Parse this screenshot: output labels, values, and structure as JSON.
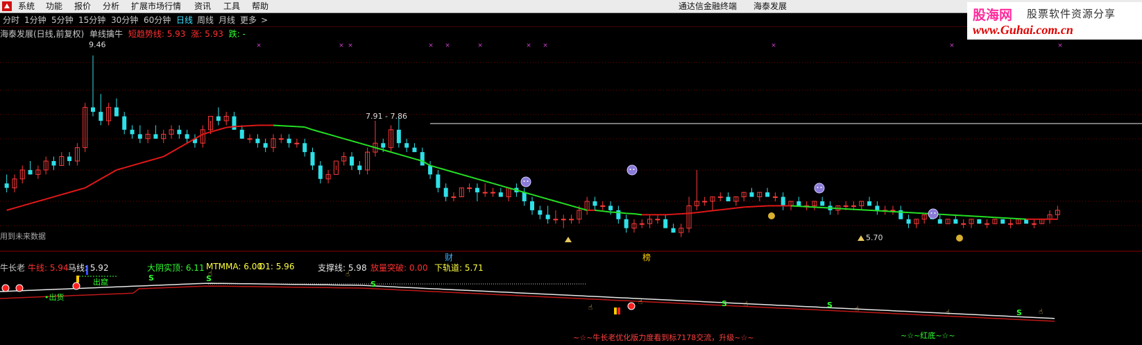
{
  "menubar": {
    "items": [
      "系统",
      "功能",
      "报价",
      "分析",
      "扩展市场行情",
      "资讯",
      "工具",
      "帮助"
    ],
    "app_title": "通达信金融终端",
    "doc_title": "海泰发展"
  },
  "brand": {
    "cn": "股海网",
    "slogan": "股票软件资源分享",
    "url": "www.Guhai.com.cn"
  },
  "tabs": [
    {
      "label": "分时",
      "active": false
    },
    {
      "label": "1分钟",
      "active": false
    },
    {
      "label": "5分钟",
      "active": false
    },
    {
      "label": "15分钟",
      "active": false
    },
    {
      "label": "30分钟",
      "active": false
    },
    {
      "label": "60分钟",
      "active": false
    },
    {
      "label": "日线",
      "active": true
    },
    {
      "label": "周线",
      "active": false
    },
    {
      "label": "月线",
      "active": false
    },
    {
      "label": "更多",
      "active": false
    },
    {
      "label": ">",
      "active": false
    }
  ],
  "main_legend": {
    "stock": "海泰发展(日线,前复权)",
    "indicator": "单线擒牛",
    "trend_label": "短趋势线: 5.93",
    "up_label": "涨: 5.93",
    "down_label": "跌: -"
  },
  "future_data_note": "用到未来数据",
  "sub_legend": {
    "name": "牛长老",
    "niu": "牛线: 5.94",
    "ma": "马线: 5.92",
    "dayang": "大阴实顶: 6.11",
    "mtmma": "MTMMA: 6.00",
    "d1": "D1: 5.96",
    "zhicheng": "支撑线: 5.98",
    "fangliang": "放量突破: 0.00",
    "xiaguidao": "下轨道: 5.71"
  },
  "annotations": {
    "high": "9.46",
    "mid": "7.91 - 7.86",
    "low": "5.70",
    "cai": "财",
    "bang": "榜",
    "chuhuo": "•出货",
    "chuku": "出窟",
    "fenghuo": "...",
    "bottom_text": "~☆~牛长老优化版力度看到标7178交流，升级~☆~",
    "hongdi": "~☆~红底~☆~",
    "s_mark": "S"
  },
  "colors": {
    "up": "#ff3a3a",
    "down": "#2ee0e8",
    "ma_up": "#e01818",
    "ma_down": "#24e024",
    "grid": "#7a0000",
    "menubar": "#ebebeb",
    "accent_tab": "#3fe0ff"
  },
  "icons": {
    "app_logo": "red-logo-icon",
    "face": "purple-face-icon",
    "money_bag": "money-bag-icon"
  },
  "chart_data": {
    "type": "candlestick",
    "ylim": [
      5.3,
      9.8
    ],
    "candles": [
      [
        6.6,
        6.8,
        6.4,
        6.5
      ],
      [
        6.5,
        6.8,
        6.4,
        6.7
      ],
      [
        6.7,
        7.0,
        6.6,
        6.9
      ],
      [
        6.9,
        7.1,
        6.8,
        6.8
      ],
      [
        6.8,
        7.0,
        6.7,
        6.9
      ],
      [
        6.9,
        7.2,
        6.8,
        7.1
      ],
      [
        7.1,
        7.2,
        6.9,
        7.0
      ],
      [
        7.0,
        7.3,
        7.0,
        7.2
      ],
      [
        7.2,
        7.3,
        7.0,
        7.1
      ],
      [
        7.1,
        7.5,
        7.0,
        7.4
      ],
      [
        7.4,
        8.4,
        7.3,
        8.3
      ],
      [
        8.3,
        9.46,
        8.1,
        8.2
      ],
      [
        8.2,
        8.6,
        7.9,
        8.0
      ],
      [
        8.0,
        8.4,
        7.9,
        8.3
      ],
      [
        8.3,
        8.5,
        8.1,
        8.1
      ],
      [
        8.1,
        8.2,
        7.7,
        7.8
      ],
      [
        7.8,
        7.9,
        7.6,
        7.7
      ],
      [
        7.7,
        7.9,
        7.5,
        7.6
      ],
      [
        7.6,
        7.8,
        7.5,
        7.7
      ],
      [
        7.7,
        7.9,
        7.6,
        7.6
      ],
      [
        7.6,
        7.8,
        7.5,
        7.7
      ],
      [
        7.7,
        7.9,
        7.6,
        7.8
      ],
      [
        7.8,
        7.9,
        7.6,
        7.7
      ],
      [
        7.7,
        7.8,
        7.5,
        7.6
      ],
      [
        7.6,
        7.7,
        7.4,
        7.5
      ],
      [
        7.5,
        7.9,
        7.4,
        7.8
      ],
      [
        7.8,
        8.0,
        7.7,
        8.1
      ],
      [
        8.1,
        8.3,
        7.9,
        8.0
      ],
      [
        8.0,
        8.2,
        7.9,
        8.1
      ],
      [
        8.1,
        8.2,
        7.8,
        7.8
      ],
      [
        7.8,
        7.9,
        7.6,
        7.6
      ],
      [
        7.6,
        7.7,
        7.5,
        7.6
      ],
      [
        7.6,
        7.7,
        7.4,
        7.5
      ],
      [
        7.5,
        7.6,
        7.3,
        7.4
      ],
      [
        7.4,
        7.7,
        7.3,
        7.6
      ],
      [
        7.6,
        7.7,
        7.5,
        7.6
      ],
      [
        7.6,
        7.7,
        7.4,
        7.5
      ],
      [
        7.5,
        7.6,
        7.4,
        7.5
      ],
      [
        7.5,
        7.6,
        7.2,
        7.3
      ],
      [
        7.3,
        7.4,
        6.9,
        7.0
      ],
      [
        7.0,
        7.1,
        6.6,
        6.7
      ],
      [
        6.7,
        6.9,
        6.6,
        6.8
      ],
      [
        6.8,
        7.0,
        6.9,
        7.1
      ],
      [
        7.1,
        7.3,
        7.0,
        7.2
      ],
      [
        7.2,
        7.3,
        6.9,
        7.0
      ],
      [
        7.0,
        7.1,
        6.8,
        6.9
      ],
      [
        6.9,
        7.4,
        6.8,
        7.3
      ],
      [
        7.3,
        8.0,
        7.2,
        7.5
      ],
      [
        7.5,
        7.6,
        7.3,
        7.4
      ],
      [
        7.4,
        7.9,
        7.3,
        7.8
      ],
      [
        7.8,
        8.1,
        7.4,
        7.5
      ],
      [
        7.5,
        7.6,
        7.3,
        7.4
      ],
      [
        7.4,
        7.5,
        7.3,
        7.3
      ],
      [
        7.3,
        7.4,
        7.0,
        7.0
      ],
      [
        7.0,
        7.1,
        6.7,
        6.8
      ],
      [
        6.8,
        6.9,
        6.4,
        6.5
      ],
      [
        6.5,
        6.6,
        6.2,
        6.3
      ],
      [
        6.3,
        6.4,
        6.2,
        6.3
      ],
      [
        6.3,
        6.5,
        6.3,
        6.5
      ],
      [
        6.5,
        6.6,
        6.4,
        6.5
      ],
      [
        6.5,
        6.6,
        6.2,
        6.4
      ],
      [
        6.4,
        6.6,
        6.3,
        6.4
      ],
      [
        6.4,
        6.5,
        6.3,
        6.4
      ],
      [
        6.4,
        6.5,
        6.3,
        6.3
      ],
      [
        6.3,
        6.5,
        6.2,
        6.5
      ],
      [
        6.5,
        6.6,
        6.3,
        6.4
      ],
      [
        6.4,
        6.5,
        6.1,
        6.2
      ],
      [
        6.2,
        6.3,
        5.9,
        6.0
      ],
      [
        6.0,
        6.1,
        5.8,
        5.9
      ],
      [
        5.9,
        6.1,
        5.7,
        5.8
      ],
      [
        5.8,
        6.0,
        5.7,
        5.8
      ],
      [
        5.8,
        5.9,
        5.6,
        5.8
      ],
      [
        5.8,
        5.9,
        5.7,
        5.8
      ],
      [
        5.8,
        6.1,
        5.7,
        6.0
      ],
      [
        6.0,
        6.3,
        5.9,
        6.2
      ],
      [
        6.2,
        6.3,
        6.0,
        6.1
      ],
      [
        6.1,
        6.2,
        6.0,
        6.1
      ],
      [
        6.1,
        6.2,
        5.9,
        6.0
      ],
      [
        6.0,
        6.1,
        5.7,
        5.8
      ],
      [
        5.8,
        5.9,
        5.5,
        5.6
      ],
      [
        5.6,
        5.8,
        5.5,
        5.7
      ],
      [
        5.7,
        5.8,
        5.6,
        5.7
      ],
      [
        5.7,
        5.9,
        5.6,
        5.8
      ],
      [
        5.8,
        5.9,
        5.7,
        5.8
      ],
      [
        5.8,
        5.9,
        5.6,
        5.6
      ],
      [
        5.6,
        5.7,
        5.5,
        5.5
      ],
      [
        5.5,
        5.7,
        5.4,
        5.6
      ],
      [
        5.6,
        6.3,
        5.5,
        6.1
      ],
      [
        6.1,
        6.9,
        6.0,
        6.2
      ],
      [
        6.2,
        6.3,
        6.1,
        6.2
      ],
      [
        6.2,
        6.3,
        6.0,
        6.3
      ],
      [
        6.3,
        6.4,
        6.2,
        6.3
      ],
      [
        6.3,
        6.4,
        6.2,
        6.2
      ],
      [
        6.2,
        6.3,
        6.1,
        6.3
      ],
      [
        6.3,
        6.4,
        6.2,
        6.4
      ],
      [
        6.4,
        6.5,
        6.3,
        6.3
      ],
      [
        6.3,
        6.4,
        6.2,
        6.4
      ],
      [
        6.4,
        6.5,
        6.3,
        6.3
      ],
      [
        6.3,
        6.4,
        6.2,
        6.3
      ],
      [
        6.3,
        6.4,
        6.0,
        6.1
      ],
      [
        6.1,
        6.2,
        6.0,
        6.2
      ],
      [
        6.2,
        6.3,
        6.1,
        6.1
      ],
      [
        6.1,
        6.2,
        6.0,
        6.1
      ],
      [
        6.1,
        6.2,
        6.0,
        6.2
      ],
      [
        6.2,
        6.3,
        6.1,
        6.1
      ],
      [
        6.1,
        6.2,
        5.9,
        6.0
      ],
      [
        6.0,
        6.1,
        5.9,
        6.1
      ],
      [
        6.1,
        6.2,
        6.0,
        6.1
      ],
      [
        6.1,
        6.2,
        6.0,
        6.1
      ],
      [
        6.1,
        6.2,
        6.0,
        6.2
      ],
      [
        6.2,
        6.3,
        6.1,
        6.1
      ],
      [
        6.1,
        6.2,
        5.9,
        6.0
      ],
      [
        6.0,
        6.1,
        5.9,
        6.0
      ],
      [
        6.0,
        6.1,
        5.9,
        6.0
      ],
      [
        6.0,
        6.1,
        5.8,
        5.8
      ],
      [
        5.8,
        5.9,
        5.6,
        5.7
      ],
      [
        5.7,
        5.8,
        5.6,
        5.8
      ],
      [
        5.8,
        5.9,
        5.7,
        5.9
      ],
      [
        5.9,
        6.0,
        5.8,
        5.8
      ],
      [
        5.8,
        5.9,
        5.7,
        5.7
      ],
      [
        5.7,
        5.8,
        5.7,
        5.8
      ],
      [
        5.8,
        5.9,
        5.7,
        5.7
      ],
      [
        5.7,
        5.8,
        5.6,
        5.7
      ],
      [
        5.7,
        5.8,
        5.6,
        5.8
      ],
      [
        5.8,
        5.8,
        5.7,
        5.7
      ],
      [
        5.7,
        5.8,
        5.6,
        5.7
      ],
      [
        5.7,
        5.8,
        5.7,
        5.8
      ],
      [
        5.8,
        5.8,
        5.7,
        5.7
      ],
      [
        5.7,
        5.8,
        5.6,
        5.7
      ],
      [
        5.7,
        5.8,
        5.7,
        5.8
      ],
      [
        5.8,
        5.8,
        5.7,
        5.7
      ],
      [
        5.7,
        5.8,
        5.6,
        5.7
      ],
      [
        5.7,
        5.8,
        5.7,
        5.8
      ],
      [
        5.8,
        6.0,
        5.7,
        5.9
      ],
      [
        5.9,
        6.1,
        5.8,
        6.0
      ]
    ],
    "ma": [
      6.0,
      6.05,
      6.1,
      6.15,
      6.2,
      6.25,
      6.3,
      6.35,
      6.4,
      6.45,
      6.5,
      6.6,
      6.7,
      6.8,
      6.9,
      6.95,
      7.0,
      7.05,
      7.1,
      7.15,
      7.2,
      7.3,
      7.4,
      7.5,
      7.6,
      7.7,
      7.75,
      7.8,
      7.85,
      7.87,
      7.88,
      7.89,
      7.9,
      7.9,
      7.9,
      7.89,
      7.88,
      7.87,
      7.86,
      7.8,
      7.75,
      7.7,
      7.65,
      7.6,
      7.55,
      7.5,
      7.45,
      7.4,
      7.35,
      7.3,
      7.25,
      7.2,
      7.15,
      7.1,
      7.0,
      6.95,
      6.9,
      6.85,
      6.8,
      6.75,
      6.7,
      6.65,
      6.6,
      6.55,
      6.5,
      6.45,
      6.4,
      6.35,
      6.3,
      6.25,
      6.2,
      6.15,
      6.1,
      6.05,
      6.0,
      6.0,
      5.98,
      5.96,
      5.95,
      5.93,
      5.92,
      5.9,
      5.9,
      5.9,
      5.9,
      5.91,
      5.92,
      5.93,
      5.95,
      5.97,
      5.99,
      6.01,
      6.03,
      6.05,
      6.07,
      6.08,
      6.09,
      6.1,
      6.1,
      6.1,
      6.1,
      6.09,
      6.08,
      6.07,
      6.06,
      6.05,
      6.04,
      6.03,
      6.02,
      6.01,
      6.0,
      5.99,
      5.98,
      5.97,
      5.96,
      5.95,
      5.94,
      5.93,
      5.92,
      5.91,
      5.9,
      5.89,
      5.88,
      5.87,
      5.86,
      5.85,
      5.84,
      5.83,
      5.82,
      5.81,
      5.8,
      5.8,
      5.8,
      5.8,
      5.8
    ]
  }
}
